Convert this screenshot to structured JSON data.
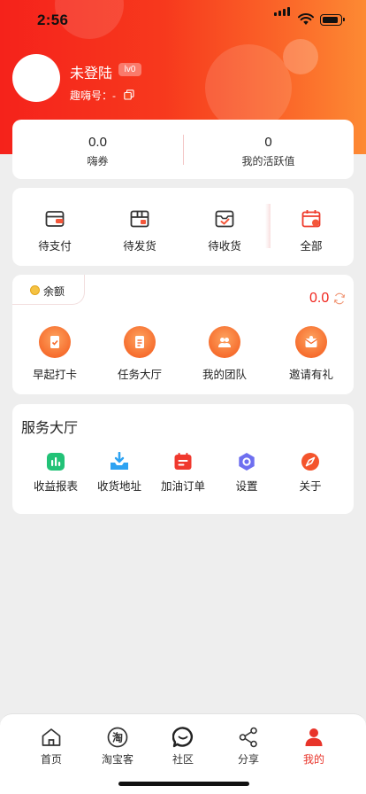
{
  "status_bar": {
    "time": "2:56"
  },
  "profile": {
    "name": "未登陆",
    "level": "lv0",
    "id_text": "趣嗨号：-"
  },
  "stats": [
    {
      "value": "0.0",
      "label": "嗨券"
    },
    {
      "value": "0",
      "label": "我的活跃值"
    }
  ],
  "orders": [
    {
      "label": "待支付",
      "icon": "wallet-card-icon"
    },
    {
      "label": "待发货",
      "icon": "box-icon"
    },
    {
      "label": "待收货",
      "icon": "inbox-check-icon"
    },
    {
      "label": "全部",
      "icon": "calendar-icon"
    }
  ],
  "wallet": {
    "balance_label": "余额",
    "balance_value": "0.0",
    "items": [
      {
        "label": "早起打卡",
        "icon": "check-in-icon"
      },
      {
        "label": "任务大厅",
        "icon": "task-icon"
      },
      {
        "label": "我的团队",
        "icon": "team-icon"
      },
      {
        "label": "邀请有礼",
        "icon": "gift-envelope-icon"
      }
    ]
  },
  "services": {
    "title": "服务大厅",
    "items": [
      {
        "label": "收益报表",
        "icon": "chart-icon"
      },
      {
        "label": "收货地址",
        "icon": "download-tray-icon"
      },
      {
        "label": "加油订单",
        "icon": "order-calendar-icon"
      },
      {
        "label": "设置",
        "icon": "hexagon-settings-icon"
      },
      {
        "label": "关于",
        "icon": "compass-icon"
      }
    ]
  },
  "tabbar": [
    {
      "label": "首页",
      "icon": "home-icon"
    },
    {
      "label": "淘宝客",
      "icon": "taobao-icon",
      "glyph": "淘"
    },
    {
      "label": "社区",
      "icon": "chat-bubble-icon"
    },
    {
      "label": "分享",
      "icon": "share-icon"
    },
    {
      "label": "我的",
      "icon": "person-icon",
      "active": true
    }
  ],
  "colors": {
    "header_start": "#f5221b",
    "header_end": "#fd8a33",
    "accent": "#e8342a",
    "wallet_icon": "#f66a2b"
  }
}
